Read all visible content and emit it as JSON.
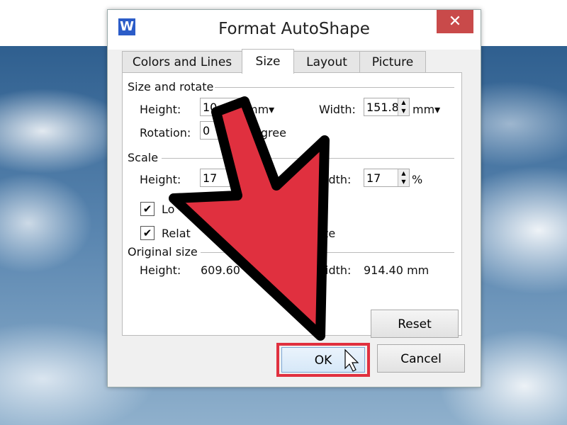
{
  "dialog": {
    "title": "Format AutoShape",
    "app_icon": "W",
    "close_label": "✕",
    "tabs": [
      {
        "label": "Colors and Lines"
      },
      {
        "label": "Size",
        "active": true
      },
      {
        "label": "Layout"
      },
      {
        "label": "Picture"
      }
    ],
    "size_rotate": {
      "heading": "Size and rotate",
      "height_label": "Height:",
      "height_value": "10",
      "height_unit": "mm▾",
      "width_label": "Width:",
      "width_value": "151.8",
      "width_unit": "mm▾",
      "rotation_label": "Rotation:",
      "rotation_value": "0",
      "rotation_unit": "egree"
    },
    "scale": {
      "heading": "Scale",
      "height_label": "Height:",
      "height_value": "17",
      "width_label": "idth:",
      "width_value": "17",
      "width_unit": "%",
      "lock_label": "Lo",
      "lock_checked": true,
      "relative_label": "Relat",
      "relative_label_end": "ze",
      "relative_checked": true
    },
    "original": {
      "heading": "Original size",
      "height_label": "Height:",
      "height_value": "609.60",
      "width_label": "idth:",
      "width_value": "914.40 mm"
    },
    "buttons": {
      "reset": "Reset",
      "ok": "OK",
      "cancel": "Cancel"
    }
  },
  "colors": {
    "arrow": "#e0303f",
    "highlight": "#e0303f",
    "close": "#c94a4a"
  }
}
